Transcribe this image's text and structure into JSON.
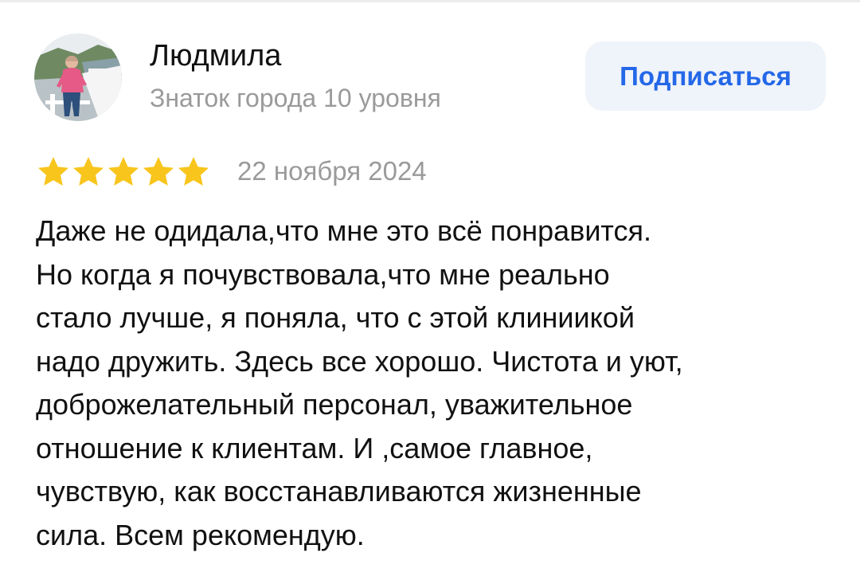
{
  "author": {
    "name": "Людмила",
    "level": "Знаток города 10 уровня"
  },
  "subscribe_button": {
    "label": "Подписаться"
  },
  "review": {
    "rating": 5,
    "max_rating": 5,
    "date": "22 ноября 2024",
    "lines": [
      "Даже не одидала,что мне это всё понравится.",
      "Но когда я почувствовала,что мне реально",
      "стало лучше, я поняла, что с этой клиниикой",
      "надо дружить. Здесь все хорошо. Чистота и уют,",
      "доброжелательный персонал, уважительное",
      "отношение к клиентам. И ,самое главное,",
      "чувствую, как восстанавливаются жизненные",
      "сила. Всем рекомендую."
    ]
  },
  "icons": {
    "avatar": "user-photo-icon",
    "star": "star-icon"
  },
  "colors": {
    "star": "#f8c51c",
    "accent": "#2468e8",
    "button_bg": "#eff3fa",
    "muted_text": "#9a9a9a",
    "main_text": "#111111"
  }
}
